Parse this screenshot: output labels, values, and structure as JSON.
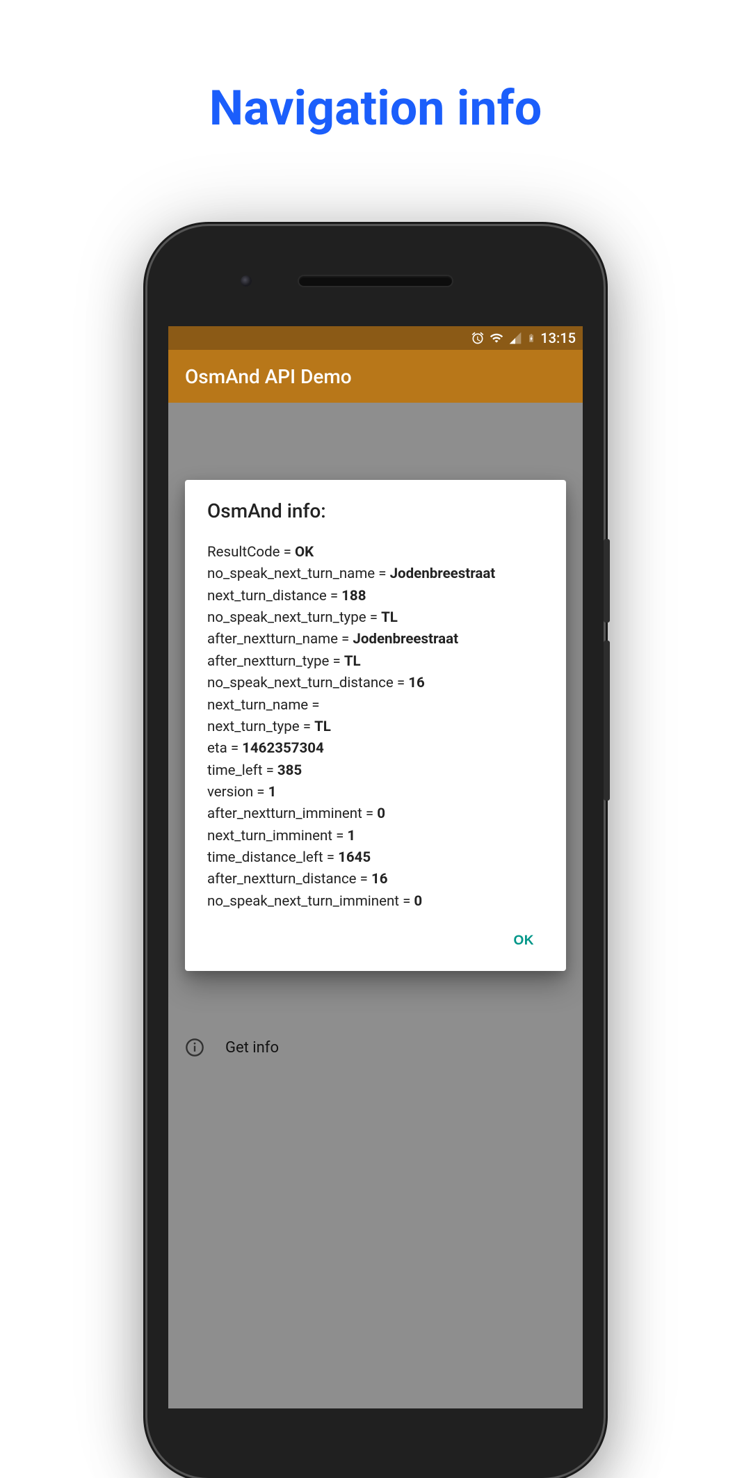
{
  "page_heading": "Navigation info",
  "statusbar": {
    "time": "13:15"
  },
  "appbar": {
    "title": "OsmAnd API Demo"
  },
  "background_list": {
    "get_info_label": "Get info"
  },
  "dialog": {
    "title": "OsmAnd info:",
    "ok_label": "OK",
    "fields": [
      {
        "key": "ResultCode",
        "value": "OK"
      },
      {
        "key": "no_speak_next_turn_name",
        "value": "Jodenbreestraat"
      },
      {
        "key": "next_turn_distance",
        "value": "188"
      },
      {
        "key": "no_speak_next_turn_type",
        "value": "TL"
      },
      {
        "key": "after_nextturn_name",
        "value": "Jodenbreestraat"
      },
      {
        "key": "after_nextturn_type",
        "value": "TL"
      },
      {
        "key": "no_speak_next_turn_distance",
        "value": "16"
      },
      {
        "key": "next_turn_name",
        "value": ""
      },
      {
        "key": "next_turn_type",
        "value": "TL"
      },
      {
        "key": "eta",
        "value": "1462357304"
      },
      {
        "key": "time_left",
        "value": "385"
      },
      {
        "key": "version",
        "value": "1"
      },
      {
        "key": "after_nextturn_imminent",
        "value": "0"
      },
      {
        "key": "next_turn_imminent",
        "value": "1"
      },
      {
        "key": "time_distance_left",
        "value": "1645"
      },
      {
        "key": "after_nextturn_distance",
        "value": "16"
      },
      {
        "key": "no_speak_next_turn_imminent",
        "value": "0"
      }
    ]
  }
}
